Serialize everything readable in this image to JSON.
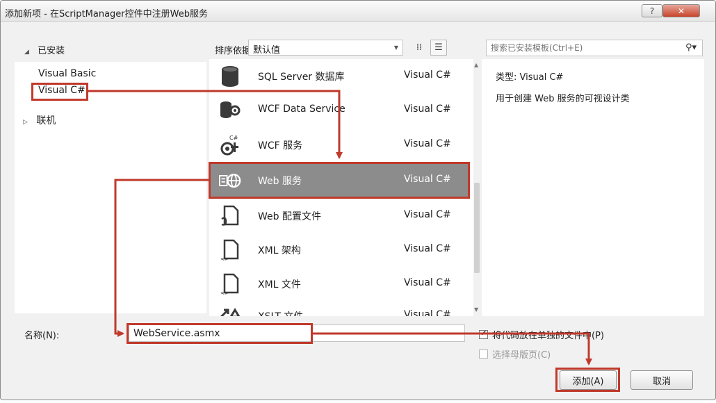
{
  "window": {
    "title": "添加新项 - 在ScriptManager控件中注册Web服务",
    "help_label": "?",
    "close_label": "✕"
  },
  "left_pane": {
    "installed_label": "已安装",
    "items": [
      {
        "label": "Visual Basic"
      },
      {
        "label": "Visual C#"
      }
    ],
    "online_label": "联机"
  },
  "toolbar": {
    "sort_label": "排序依据:",
    "sort_value": "默认值"
  },
  "search": {
    "placeholder": "搜索已安装模板(Ctrl+E)"
  },
  "templates": [
    {
      "name": "SQL Server 数据库",
      "lang": "Visual C#",
      "icon": "database-icon"
    },
    {
      "name": "WCF Data Service",
      "lang": "Visual C#",
      "icon": "wcf-data-service-icon"
    },
    {
      "name": "WCF 服务",
      "lang": "Visual C#",
      "icon": "wcf-service-icon"
    },
    {
      "name": "Web 服务",
      "lang": "Visual C#",
      "icon": "web-service-icon",
      "selected": true
    },
    {
      "name": "Web 配置文件",
      "lang": "Visual C#",
      "icon": "web-config-icon"
    },
    {
      "name": "XML 架构",
      "lang": "Visual C#",
      "icon": "xml-schema-icon"
    },
    {
      "name": "XML 文件",
      "lang": "Visual C#",
      "icon": "xml-file-icon"
    },
    {
      "name": "XSLT 文件",
      "lang": "Visual C#",
      "icon": "xslt-file-icon"
    }
  ],
  "details": {
    "type_label": "类型:",
    "type_value": "Visual C#",
    "description": "用于创建 Web 服务的可视设计类"
  },
  "form": {
    "name_label": "名称(N):",
    "name_value": "WebService.asmx",
    "separate_file_label": "将代码放在单独的文件中(P)",
    "master_page_label": "选择母版页(C)"
  },
  "buttons": {
    "add_label": "添加(A)",
    "cancel_label": "取消"
  },
  "colors": {
    "highlight": "#c0392b",
    "selected_row": "#8c8c8c"
  }
}
